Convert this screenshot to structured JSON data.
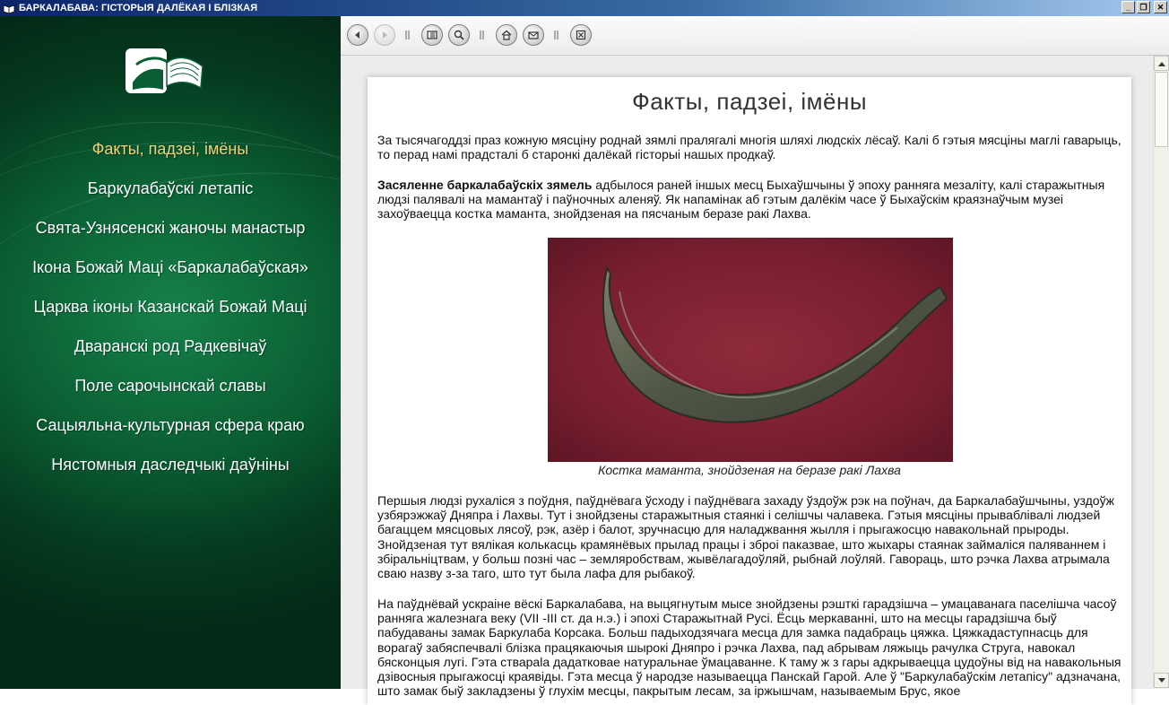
{
  "window": {
    "title": "БАРКАЛАБАВА: ГІСТОРЫЯ ДАЛЁКАЯ І БЛІЗКАЯ",
    "minimize": "_",
    "maximize": "❐",
    "close": "✕"
  },
  "sidebar": {
    "logo_icon": "book-logo-icon",
    "items": [
      {
        "label": "Факты, падзеі, імёны",
        "active": true
      },
      {
        "label": "Баркулабаўскі летапіс"
      },
      {
        "label": "Свята-Узнясенскі жаночы манастыр"
      },
      {
        "label": "Ікона Божай Маці «Баркалабаўская»"
      },
      {
        "label": "Царква іконы Казанскай Божай Маці"
      },
      {
        "label": "Дваранскі род Радкевічаў"
      },
      {
        "label": "Поле сарочынскай славы"
      },
      {
        "label": "Сацыяльна-культурная сфера краю"
      },
      {
        "label": "Нястомныя даследчыкі даўніны"
      }
    ],
    "active_color": "#f1d27a"
  },
  "toolbar": {
    "icons": [
      "back-arrow-icon",
      "forward-arrow-icon",
      "contents-icon",
      "search-icon",
      "home-icon",
      "mail-icon",
      "exit-icon"
    ]
  },
  "content": {
    "title": "Факты, падзеі, імёны",
    "p1": "За тысячагоддзі праз кожную мясціну роднай зямлі пралягалі многія шляхі людскіх лёсаў. Калі б гэтыя мясціны маглі гаварыць, то перад намі прадсталі б старонкі далёкай гісторыі нашых продкаў.",
    "p2_bold": "Засяленне баркалабаўскіх зямель",
    "p2_rest": " адбылося раней іншых месц Быхаўшчыны ў эпоху ранняга мезаліту, калі старажытныя людзі палявалі на мамантаў і паўночных аленяў. Як напамінак аб гэтым далёкім часе ў Быхаўскім краязнаўчым музеі захоўваецца костка маманта, знойдзеная на пясчаным беразе ракі Лахва.",
    "caption": "Костка маманта, знойдзеная на беразе ракі Лахва",
    "p3": "Першыя людзі рухаліся з поўдня, паўднёвага ўсходу і паўднёвага захаду ўздоўж рэк на поўнач, да Баркалабаўшчыны, уздоўж узбярэжжаў Дняпра і Лахвы. Тут і знойдзены старажытныя стаянкі і селішчы чалавека. Гэтыя мясціны прываблівалі людзей багаццем мясцовых лясоў, рэк, азёр і балот, зручнасцю для наладжвання жылля і прыгажосцю навакольнай прыроды. Знойдзеная тут вялікая колькасць крамянёвых прылад працы і зброі паказвае, што жыхары стаянак займаліся паляваннем і збіральніцтвам, у больш позні час – земляробствам, жывёлагадоўляй, рыбнай лоўляй. Гавораць, што рэчка Лахва атрымала сваю назву з-за таго, што тут была лафа для рыбакоў.",
    "p4": "На паўднёвай ускраіне вёскі Баркалабава, на выцягнутым мысе знойдзены рэшткі гарадзішча – умацаванага паселішча часоў ранняга жалезнага веку (VII -III ст. да н.э.) і эпохі Старажытнай Русі. Ёсць меркаванні, што на месцы гарадзішча быў пабудаваны замак Баркулаба Корсака. Больш падыходзячага месца для замка падабраць цяжка. Цяжкадаступнасць для ворагаў забяспечвалі блізка працякаючыя шырокі Дняпро і рэчка Лахва, пад абрывам ляжыць рачулка Струга, навокал бясконцыя лугі. Гэта ствараla дадатковае натуральнае ўмацаванне. К таму ж з гары адкрываецца цудоўны від на навакольныя дзівосныя прыгажосці краявіды. Гэта месца ў народзе называецца Панскай Гарой. Але ў \"Баркулабаўскім летапісу\" адзначана, што замак быў закладзены ў глухім месцы, пакрытым лесам, за іржышчам, называемым Брус, якое"
  },
  "colors": {
    "sidebar_green": "#0a5e33",
    "titlebar_blue": "#0a246a"
  }
}
